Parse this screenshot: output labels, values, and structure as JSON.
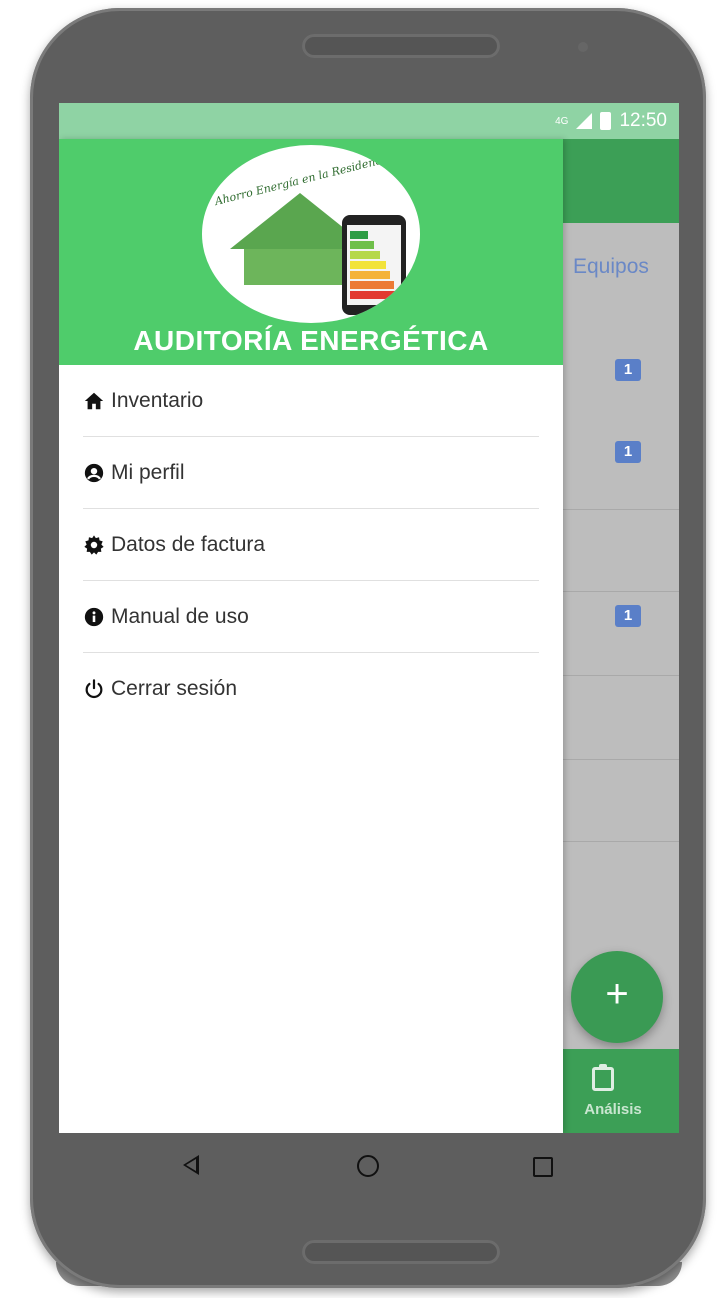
{
  "status_bar": {
    "network": "4G",
    "time": "12:50"
  },
  "background_app": {
    "tab_label": "Equipos",
    "badges": [
      "1",
      "1",
      "1"
    ],
    "fab_label": "+",
    "bottom_nav_label": "Análisis",
    "colors": {
      "toolbar": "#3c9f56",
      "badge": "#5a7fc8"
    }
  },
  "drawer": {
    "logo_script": "Ahorro Energía en la Residencia",
    "title": "AUDITORÍA ENERGÉTICA",
    "header_color": "#4fcc6b",
    "menu": [
      {
        "label": "Inventario",
        "icon": "home-icon"
      },
      {
        "label": "Mi perfil",
        "icon": "user-circle-icon"
      },
      {
        "label": "Datos de factura",
        "icon": "gear-icon"
      },
      {
        "label": "Manual de uso",
        "icon": "info-icon"
      },
      {
        "label": "Cerrar sesión",
        "icon": "power-icon"
      }
    ]
  },
  "navigation_bar": {
    "buttons": [
      "back-icon",
      "home-circle-icon",
      "recents-icon"
    ]
  }
}
